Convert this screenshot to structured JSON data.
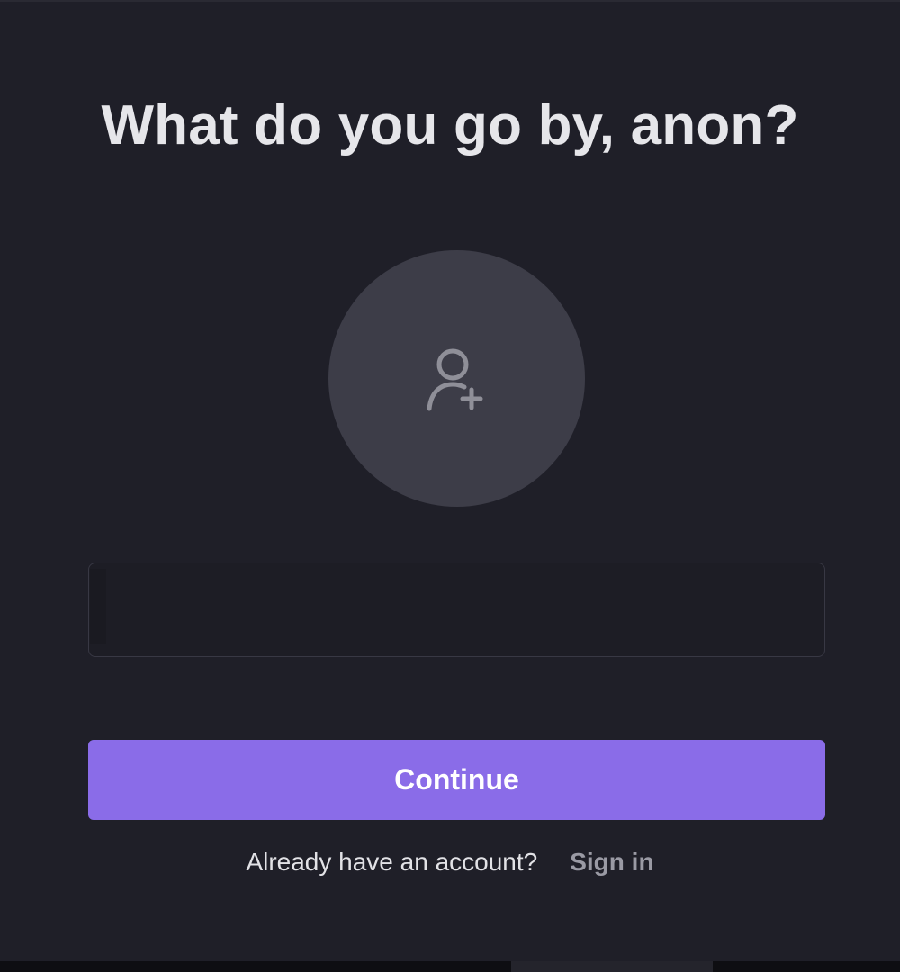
{
  "dialog": {
    "title": "What do you go by, anon?",
    "avatar_icon": "add-user-icon",
    "name_input": {
      "value": "",
      "placeholder": ""
    },
    "continue_label": "Continue",
    "signin_prompt": "Already have an account?",
    "signin_link": "Sign in"
  },
  "colors": {
    "background": "#1f1f28",
    "avatar_circle": "#3d3d48",
    "accent": "#8a6ce8",
    "title_text": "#e6e6ea",
    "muted_link": "#9a9aa4"
  }
}
